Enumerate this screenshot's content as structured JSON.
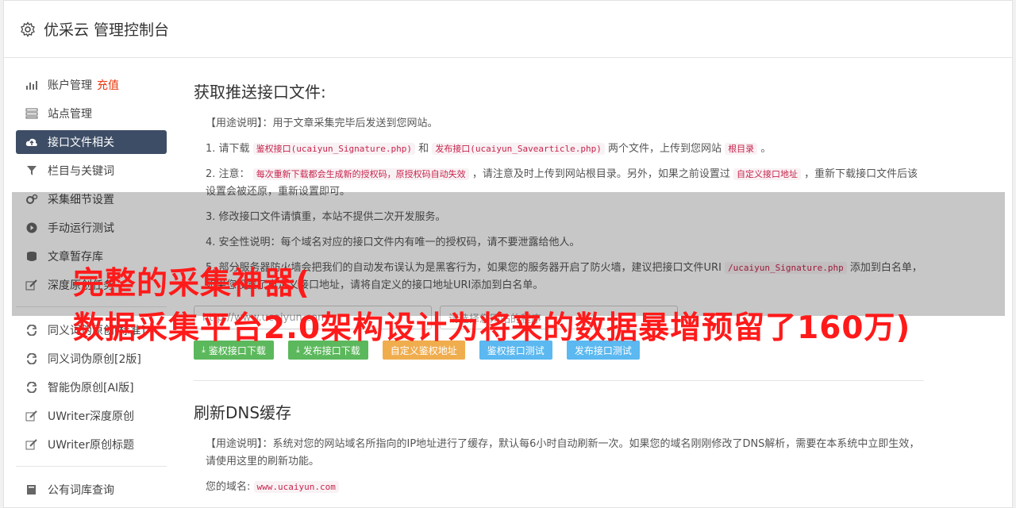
{
  "header": {
    "title": "优采云 管理控制台"
  },
  "sidebar": {
    "items": [
      {
        "label": "账户管理",
        "extra": "充值"
      },
      {
        "label": "站点管理"
      },
      {
        "label": "接口文件相关"
      },
      {
        "label": "栏目与关键词"
      },
      {
        "label": "采集细节设置"
      },
      {
        "label": "手动运行测试"
      },
      {
        "label": "文章暂存库"
      },
      {
        "label": "深度原创任务"
      },
      {
        "label": "同义词伪原创[标准]"
      },
      {
        "label": "同义词伪原创[2版]"
      },
      {
        "label": "智能伪原创[AI版]"
      },
      {
        "label": "UWriter深度原创"
      },
      {
        "label": "UWriter原创标题"
      },
      {
        "label": "公有词库查询"
      }
    ]
  },
  "main": {
    "section1": {
      "title": "获取推送接口文件:",
      "usage": "【用途说明】：用于文章采集完毕后发送到您网站。",
      "p1": {
        "a": "1. 请下载",
        "c1": "鉴权接口(ucaiyun_Signature.php)",
        "b": "和",
        "c2": "发布接口(ucaiyun_Savearticle.php)",
        "d": "两个文件，上传到您网站",
        "c3": "根目录",
        "e": "。"
      },
      "p2": {
        "a": "2. 注意：",
        "c1": "每次重新下载都会生成新的授权码，原授权码自动失效",
        "b": "，请注意及时上传到网站根目录。另外，如果之前设置过",
        "c2": "自定义接口地址",
        "d": "，重新下载接口文件后该设置会被还原，重新设置即可。"
      },
      "p3": "3. 修改接口文件请慎重，本站不提供二次开发服务。",
      "p4": "4. 安全性说明：每个域名对应的接口文件内有唯一的授权码，请不要泄露给他人。",
      "p5": {
        "a": "5. 部分服务器防火墙会把我们的自动发布误认为是黑客行为，如果您的服务器开启了防火墙，建议把接口文件URI",
        "c1": "/ucaiyun_Signature.php",
        "b": "添加到白名单，如果您设置了自定义接口地址，请将自定义的接口地址URI添加到白名单。"
      },
      "input_url": "http://www.ucaiyun.com",
      "input_select": "请选择您网站的程序",
      "buttons": [
        "鉴权接口下载",
        "发布接口下载",
        "自定义鉴权地址",
        "鉴权接口测试",
        "发布接口测试"
      ]
    },
    "section2": {
      "title": "刷新DNS缓存",
      "usage": "【用途说明】：系统对您的网站域名所指向的IP地址进行了缓存，默认每6小时自动刷新一次。如果您的域名刚刚修改了DNS解析，需要在本系统中立即生效，请使用这里的刷新功能。",
      "domain_label": "您的域名:",
      "domain": "www.ucaiyun.com"
    }
  },
  "overlay": {
    "line1": "完整的采集神器(",
    "line2": "数据采集平台2.0架构设计为将来的数据暴增预留了160万)"
  },
  "colors": {
    "accent": "#3e4d66",
    "highlight": "#e8380d",
    "overlay_text": "#ff1a1a"
  }
}
